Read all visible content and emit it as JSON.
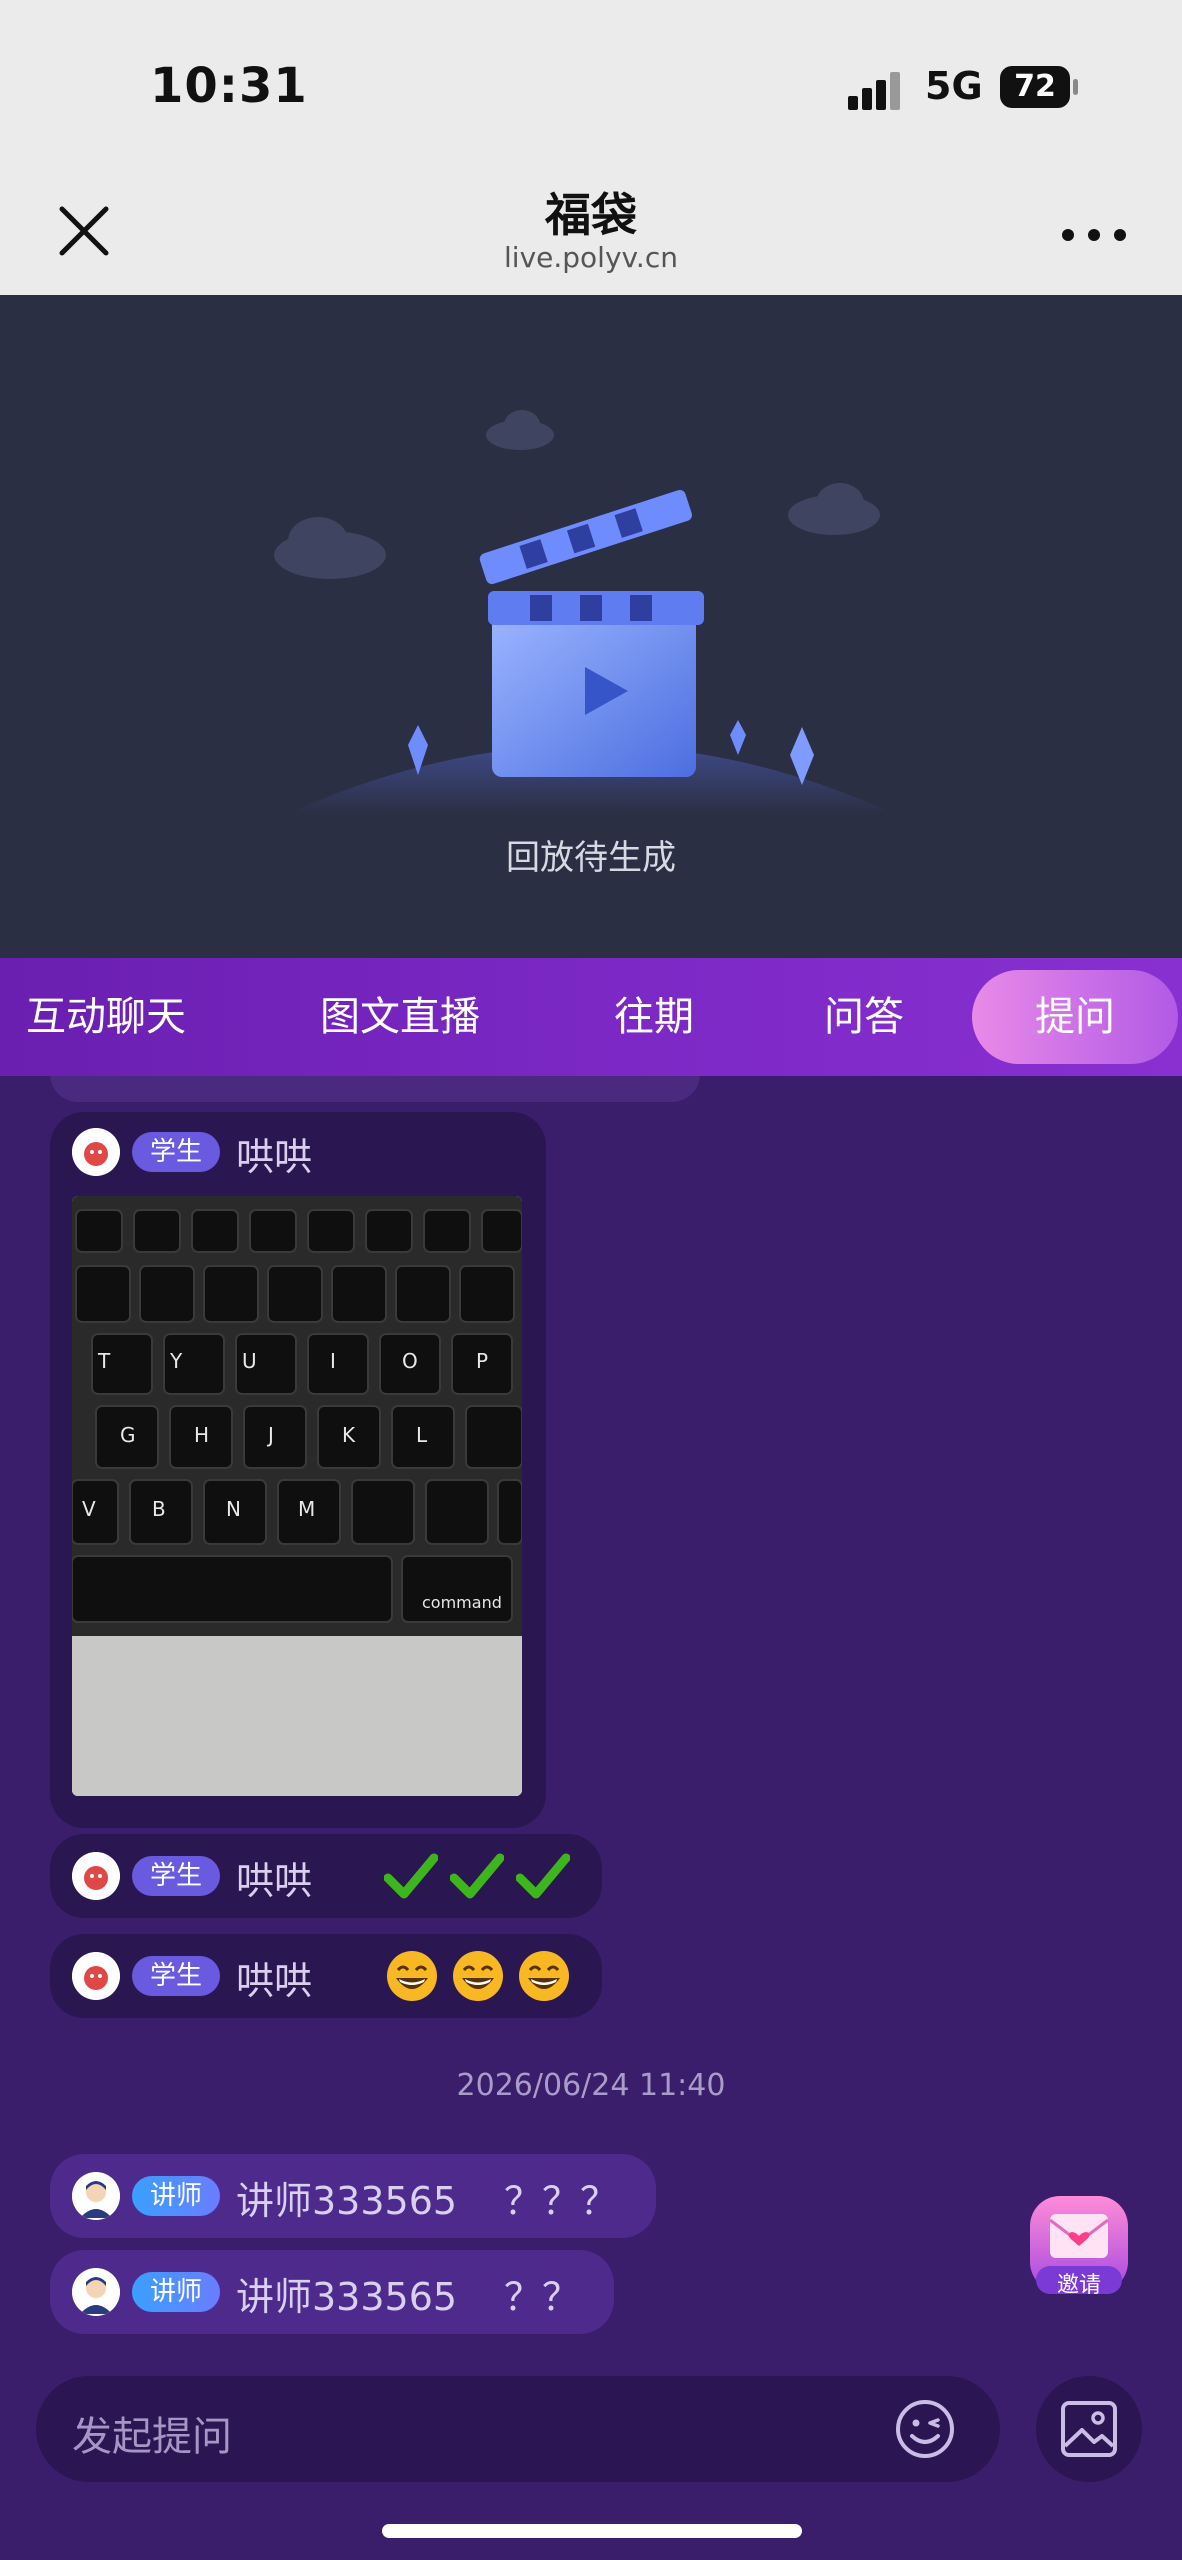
{
  "status": {
    "time": "10:31",
    "network": "5G",
    "battery": "72"
  },
  "nav": {
    "title": "福袋",
    "subtitle": "live.polyv.cn"
  },
  "player": {
    "status_text": "回放待生成"
  },
  "tabs": [
    {
      "label": "互动聊天"
    },
    {
      "label": "图文直播"
    },
    {
      "label": "往期"
    },
    {
      "label": "问答"
    },
    {
      "label": "提问",
      "active": true
    }
  ],
  "messages": [
    {
      "role": "学生",
      "name": "哄哄",
      "type": "image",
      "image_icon": "keyboard-photo"
    },
    {
      "role": "学生",
      "name": "哄哄",
      "type": "emoji",
      "emoji_icons": [
        "check-icon",
        "check-icon",
        "check-icon"
      ]
    },
    {
      "role": "学生",
      "name": "哄哄",
      "type": "emoji",
      "emoji_icons": [
        "grin-emoji",
        "grin-emoji",
        "grin-emoji"
      ]
    }
  ],
  "timestamp": "2026/06/24 11:40",
  "teacher_messages": [
    {
      "role": "讲师",
      "name": "讲师333565",
      "text": "？？？"
    },
    {
      "role": "讲师",
      "name": "讲师333565",
      "text": "？？"
    }
  ],
  "invite": {
    "label": "邀请"
  },
  "input": {
    "placeholder": "发起提问"
  },
  "colors": {
    "background": "#3a1d6b",
    "tab_bar": "#7b28c5",
    "active_tab": "#d07ae8",
    "player_bg": "#2b2f43"
  }
}
